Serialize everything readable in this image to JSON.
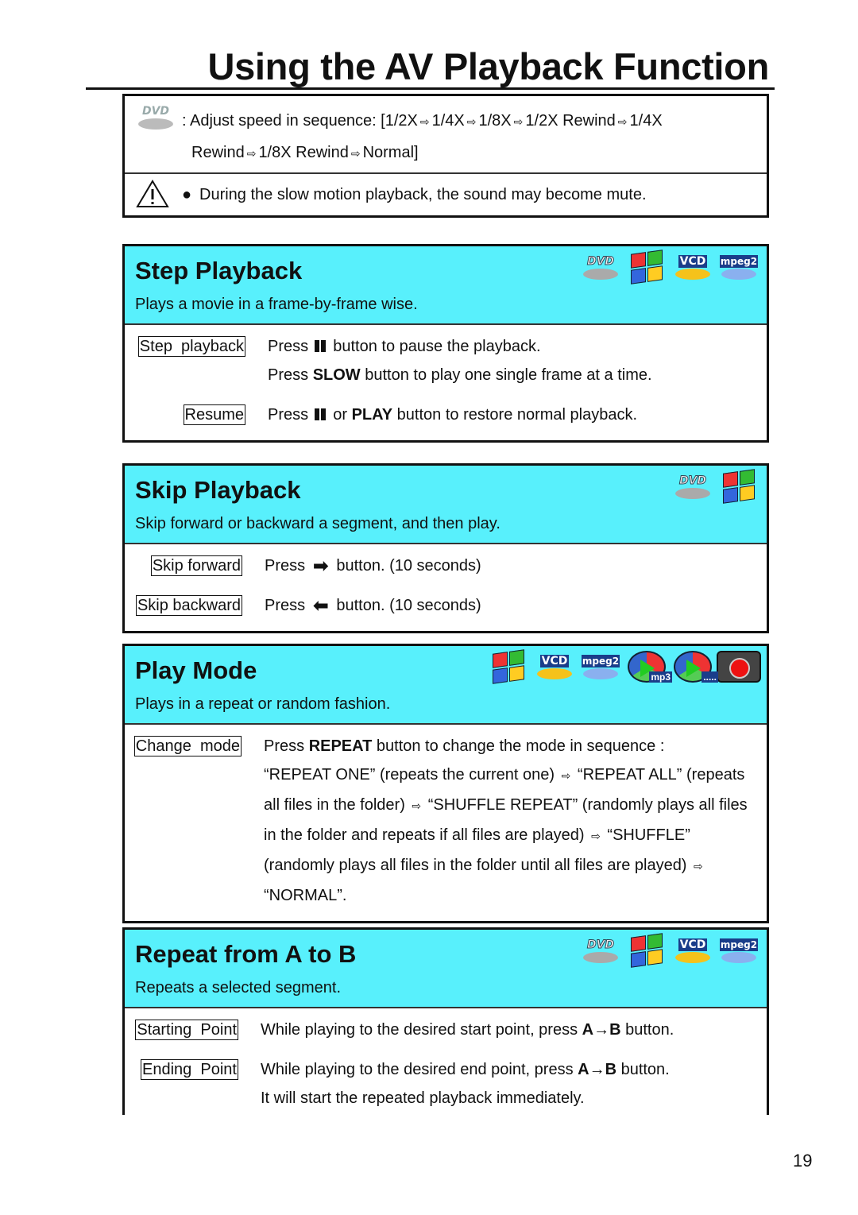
{
  "page_title": "Using the AV Playback Function",
  "page_number": "19",
  "accent_color": "#58f0fc",
  "intro": {
    "icon": "dvd-icon",
    "line1": [
      ": Adjust speed in sequence: [1/2X",
      "1/4X",
      "1/8X",
      "1/2X Rewind",
      "1/4X"
    ],
    "line2": [
      "Rewind",
      "1/8X Rewind",
      "Normal]"
    ],
    "warning_icon": "warning-triangle-icon",
    "warning_text": "During the slow motion playback, the sound may become mute."
  },
  "sections": [
    {
      "id": "step-playback",
      "title": "Step Playback",
      "desc": "Plays a movie in a frame-by-frame wise.",
      "icons": [
        "dvd-icon",
        "windows-icon",
        "vcd-icon",
        "mpeg2-icon"
      ],
      "rows": [
        {
          "label": "Step  playback",
          "lines": [
            [
              {
                "t": "Press "
              },
              {
                "icon": "pause"
              },
              {
                "t": " button to pause the playback."
              }
            ],
            [
              {
                "t": "Press "
              },
              {
                "t": "SLOW",
                "b": true
              },
              {
                "t": " button to play one single frame at a time."
              }
            ]
          ]
        },
        {
          "label": "Resume",
          "lines": [
            [
              {
                "t": "Press "
              },
              {
                "icon": "pause"
              },
              {
                "t": " or "
              },
              {
                "t": "PLAY",
                "b": true
              },
              {
                "t": " button to restore normal playback."
              }
            ]
          ]
        }
      ]
    },
    {
      "id": "skip-playback",
      "title": "Skip Playback",
      "desc": "Skip forward or backward a segment, and then play.",
      "icons": [
        "dvd-icon",
        "windows-icon"
      ],
      "rows": [
        {
          "label": "Skip forward",
          "lines": [
            [
              {
                "t": "Press "
              },
              {
                "icon": "right"
              },
              {
                "t": " button. (10 seconds)"
              }
            ]
          ]
        },
        {
          "label": "Skip backward",
          "lines": [
            [
              {
                "t": "Press "
              },
              {
                "icon": "left"
              },
              {
                "t": " button. (10 seconds)"
              }
            ]
          ]
        }
      ]
    },
    {
      "id": "play-mode",
      "title": "Play Mode",
      "desc": "Plays in a repeat or random fashion.",
      "icons": [
        "windows-icon",
        "vcd-icon",
        "mpeg2-icon",
        "mp3-icon",
        "audio-icon",
        "camera-icon"
      ],
      "rows": [
        {
          "label": "Change  mode",
          "lines": [
            [
              {
                "t": "Press "
              },
              {
                "t": "REPEAT",
                "b": true
              },
              {
                "t": " button to change the mode in sequence :"
              }
            ],
            [
              {
                "t": "“REPEAT ONE” (repeats the current one) "
              },
              {
                "icon": "arr"
              },
              {
                "t": " “REPEAT ALL” (repeats"
              }
            ],
            [
              {
                "t": "all files in the folder) "
              },
              {
                "icon": "arr"
              },
              {
                "t": " “SHUFFLE REPEAT” (randomly plays all files"
              }
            ],
            [
              {
                "t": "in the folder and repeats if all files are played) "
              },
              {
                "icon": "arr"
              },
              {
                "t": " “SHUFFLE”"
              }
            ],
            [
              {
                "t": "(randomly plays all files in the folder until all files are played) "
              },
              {
                "icon": "arr"
              }
            ],
            [
              {
                "t": "“NORMAL”."
              }
            ]
          ]
        }
      ]
    },
    {
      "id": "repeat-a-to-b",
      "title": "Repeat from A to B",
      "desc": "Repeats a selected segment.",
      "icons": [
        "dvd-icon",
        "windows-icon",
        "vcd-icon",
        "mpeg2-icon"
      ],
      "rows": [
        {
          "label": "Starting  Point",
          "lines": [
            [
              {
                "t": "While playing to the desired start point, press "
              },
              {
                "t": "A→B",
                "b": true
              },
              {
                "t": " button."
              }
            ]
          ]
        },
        {
          "label": "Ending  Point",
          "lines": [
            [
              {
                "t": "While playing to the desired end point, press "
              },
              {
                "t": "A→B",
                "b": true
              },
              {
                "t": " button."
              }
            ],
            [
              {
                "t": "It will start the repeated playback immediately."
              }
            ]
          ]
        }
      ]
    }
  ]
}
